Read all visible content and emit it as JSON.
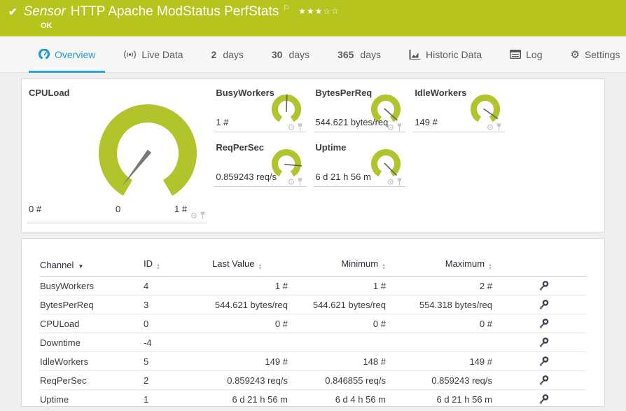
{
  "header": {
    "kind_label": "Sensor",
    "title": "HTTP Apache ModStatus PerfStats",
    "status": "OK",
    "stars_filled": "★★★",
    "stars_empty": "☆☆",
    "rating": "3 of 5"
  },
  "icons": {
    "check": "✔",
    "flag": "⚐",
    "gear": "⚙"
  },
  "colors": {
    "header_green": "#b6c41d",
    "gauge_green": "#b1c42c",
    "accent_blue": "#1d9bd7",
    "needle_gray": "#787878"
  },
  "tabs": [
    {
      "label": "Overview",
      "active": true
    },
    {
      "label": "Live Data"
    },
    {
      "num": "2",
      "text": "days"
    },
    {
      "num": "30",
      "text": "days"
    },
    {
      "num": "365",
      "text": "days"
    },
    {
      "label": "Historic Data"
    },
    {
      "label": "Log"
    },
    {
      "label": "Settings"
    }
  ],
  "gauges": {
    "primary": {
      "name": "CPULoad",
      "value": "0 #",
      "scale_min": "0",
      "scale_max": "1 #",
      "needle_deg": 218
    },
    "small": [
      {
        "name": "BusyWorkers",
        "value": "1 #",
        "needle_deg": 2
      },
      {
        "name": "BytesPerReq",
        "value": "544.621 bytes/req",
        "needle_deg": 132
      },
      {
        "name": "IdleWorkers",
        "value": "149 #",
        "needle_deg": 125
      },
      {
        "name": "ReqPerSec",
        "value": "0.859243 req/s",
        "needle_deg": 95
      },
      {
        "name": "Uptime",
        "value": "6 d 21 h 56 m",
        "needle_deg": 135
      }
    ]
  },
  "table": {
    "columns": {
      "channel": "Channel",
      "id": "ID",
      "last": "Last Value",
      "min": "Minimum",
      "max": "Maximum"
    },
    "rows": [
      {
        "channel": "BusyWorkers",
        "id": "4",
        "last": "1 #",
        "min": "1 #",
        "max": "2 #"
      },
      {
        "channel": "BytesPerReq",
        "id": "3",
        "last": "544.621 bytes/req",
        "min": "544.621 bytes/req",
        "max": "554.318 bytes/req"
      },
      {
        "channel": "CPULoad",
        "id": "0",
        "last": "0 #",
        "min": "0 #",
        "max": "0 #"
      },
      {
        "channel": "Downtime",
        "id": "-4",
        "last": "",
        "min": "",
        "max": ""
      },
      {
        "channel": "IdleWorkers",
        "id": "5",
        "last": "149 #",
        "min": "148 #",
        "max": "149 #"
      },
      {
        "channel": "ReqPerSec",
        "id": "2",
        "last": "0.859243 req/s",
        "min": "0.846855 req/s",
        "max": "0.859243 req/s"
      },
      {
        "channel": "Uptime",
        "id": "1",
        "last": "6 d 21 h 56 m",
        "min": "6 d 4 h 56 m",
        "max": "6 d 21 h 56 m"
      }
    ]
  }
}
